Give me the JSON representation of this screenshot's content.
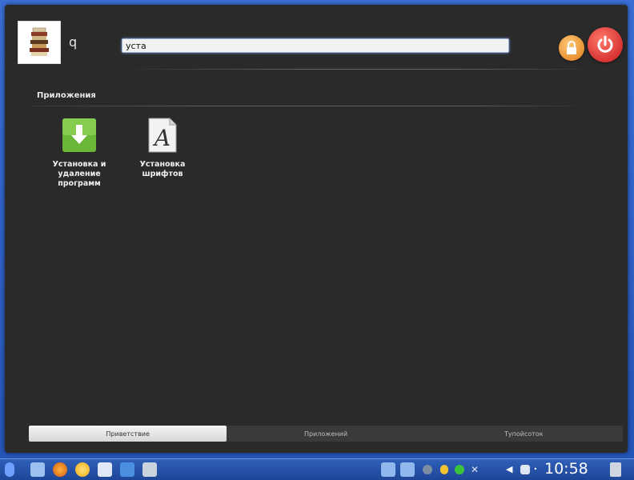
{
  "user": {
    "name": "q"
  },
  "search": {
    "value": "уста"
  },
  "section": {
    "title": "Приложения"
  },
  "results": [
    {
      "label": "Установка и удаление программ",
      "icon": "install-software-icon"
    },
    {
      "label": "Установка шрифтов",
      "icon": "font-installer-icon"
    }
  ],
  "tabs": [
    {
      "label": "Приветствие",
      "active": true
    },
    {
      "label": "Приложений",
      "active": false
    },
    {
      "label": "Тупойсоток",
      "active": false
    }
  ],
  "taskbar": {
    "clock": "10:58"
  },
  "colors": {
    "launcher_bg": "#2a2a2a",
    "accent": "#2f64c9",
    "lock": "#e07b13",
    "power": "#c4161b"
  }
}
